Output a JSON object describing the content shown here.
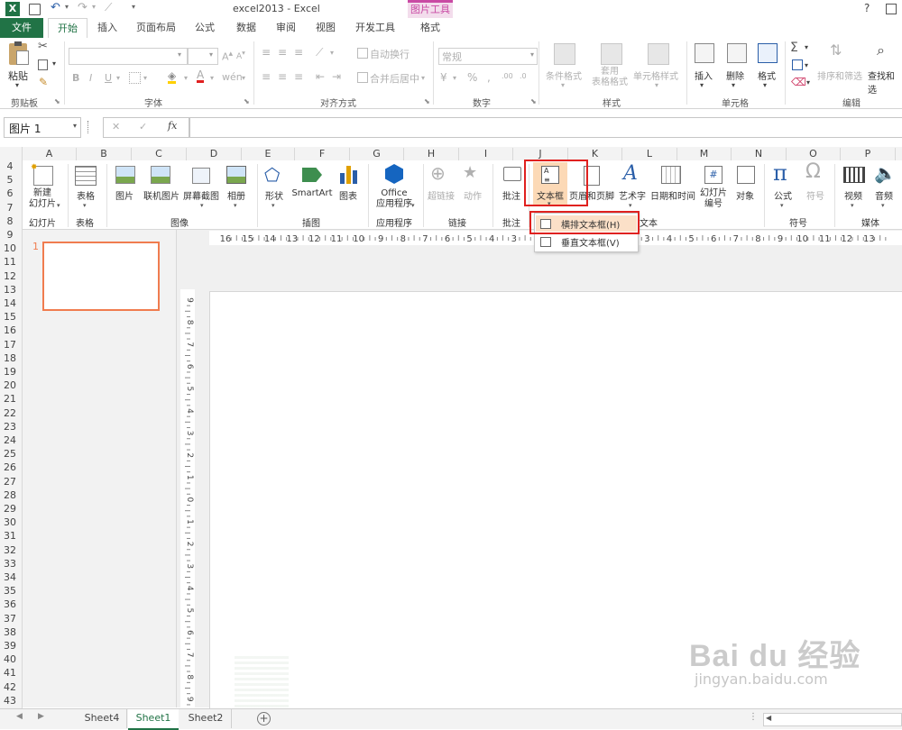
{
  "title_bar": {
    "title": "excel2013 - Excel",
    "context_group": "图片工具",
    "help": "?"
  },
  "ribbon_tabs": [
    "文件",
    "开始",
    "插入",
    "页面布局",
    "公式",
    "数据",
    "审阅",
    "视图",
    "开发工具",
    "格式"
  ],
  "active_tab": "开始",
  "ribbon": {
    "clipboard": {
      "paste": "粘贴",
      "label": "剪贴板"
    },
    "font": {
      "label": "字体",
      "bold": "B",
      "italic": "I",
      "underline": "U"
    },
    "alignment": {
      "wrap": "自动换行",
      "merge": "合并后居中",
      "label": "对齐方式"
    },
    "number": {
      "format": "常规",
      "label": "数字"
    },
    "styles": {
      "conditional": "条件格式",
      "table_format": "套用\n表格格式",
      "cell_style": "单元格样式",
      "label": "样式"
    },
    "cells": {
      "insert": "插入",
      "delete": "删除",
      "format": "格式",
      "label": "单元格"
    },
    "editing": {
      "sort": "排序和筛选",
      "find": "查找和选",
      "label": "编辑"
    }
  },
  "formula_bar": {
    "name_box": "图片 1",
    "fx": "fx",
    "cancel": "✕",
    "enter": "✓"
  },
  "columns": [
    "A",
    "B",
    "C",
    "D",
    "E",
    "F",
    "G",
    "H",
    "I",
    "J",
    "K",
    "L",
    "M",
    "N",
    "O",
    "P"
  ],
  "rows": [
    "4",
    "5",
    "6",
    "7",
    "8",
    "9",
    "10",
    "11",
    "12",
    "13",
    "14",
    "15",
    "16",
    "17",
    "18",
    "19",
    "20",
    "21",
    "22",
    "23",
    "24",
    "25",
    "26",
    "27",
    "28",
    "29",
    "30",
    "31",
    "32",
    "33",
    "34",
    "35",
    "36",
    "37",
    "38",
    "39",
    "40",
    "41",
    "42",
    "43"
  ],
  "insert_ribbon": {
    "new_slide": "新建\n幻灯片",
    "table": "表格",
    "picture": "图片",
    "online_picture": "联机图片",
    "screenshot": "屏幕截图",
    "album": "相册",
    "shapes": "形状",
    "smartart": "SmartArt",
    "chart": "图表",
    "office_apps": "Office\n应用程序",
    "hyperlink": "超链接",
    "action": "动作",
    "comment": "批注",
    "textbox": "文本框",
    "header_footer": "页眉和页脚",
    "wordart": "艺术字",
    "datetime": "日期和时间",
    "slide_number": "幻灯片\n编号",
    "object": "对象",
    "equation": "公式",
    "symbol": "符号",
    "video": "视频",
    "audio": "音频",
    "groups": {
      "slides": "幻灯片",
      "tables": "表格",
      "images": "图像",
      "illustrations": "插图",
      "apps": "应用程序",
      "links": "链接",
      "comments": "批注",
      "text": "文本",
      "symbols": "符号",
      "media": "媒体"
    }
  },
  "textbox_menu": {
    "horizontal": "横排文本框(H)",
    "vertical": "垂直文本框(V)"
  },
  "ruler_labels": [
    "16",
    "15",
    "14",
    "13",
    "12",
    "11",
    "10",
    "9",
    "8",
    "7",
    "6",
    "5",
    "4",
    "3",
    "2",
    "1",
    "0",
    "1",
    "2",
    "3",
    "4",
    "5",
    "6",
    "7",
    "8",
    "9",
    "10",
    "11",
    "12",
    "13"
  ],
  "vruler_labels": [
    "9",
    "8",
    "7",
    "6",
    "5",
    "4",
    "3",
    "2",
    "1",
    "0",
    "1",
    "2",
    "3",
    "4",
    "5",
    "6",
    "7",
    "8",
    "9"
  ],
  "slide_thumb_number": "1",
  "sheet_tabs": [
    "Sheet4",
    "Sheet1",
    "Sheet2"
  ],
  "active_sheet": "Sheet1",
  "watermark": {
    "logo": "Bai du 经验",
    "url": "jingyan.baidu.com"
  },
  "colors": {
    "excel_green": "#217346",
    "accent_red": "#e0211f",
    "context_pink": "#c94aa4",
    "thumb_border": "#f07c4f"
  }
}
